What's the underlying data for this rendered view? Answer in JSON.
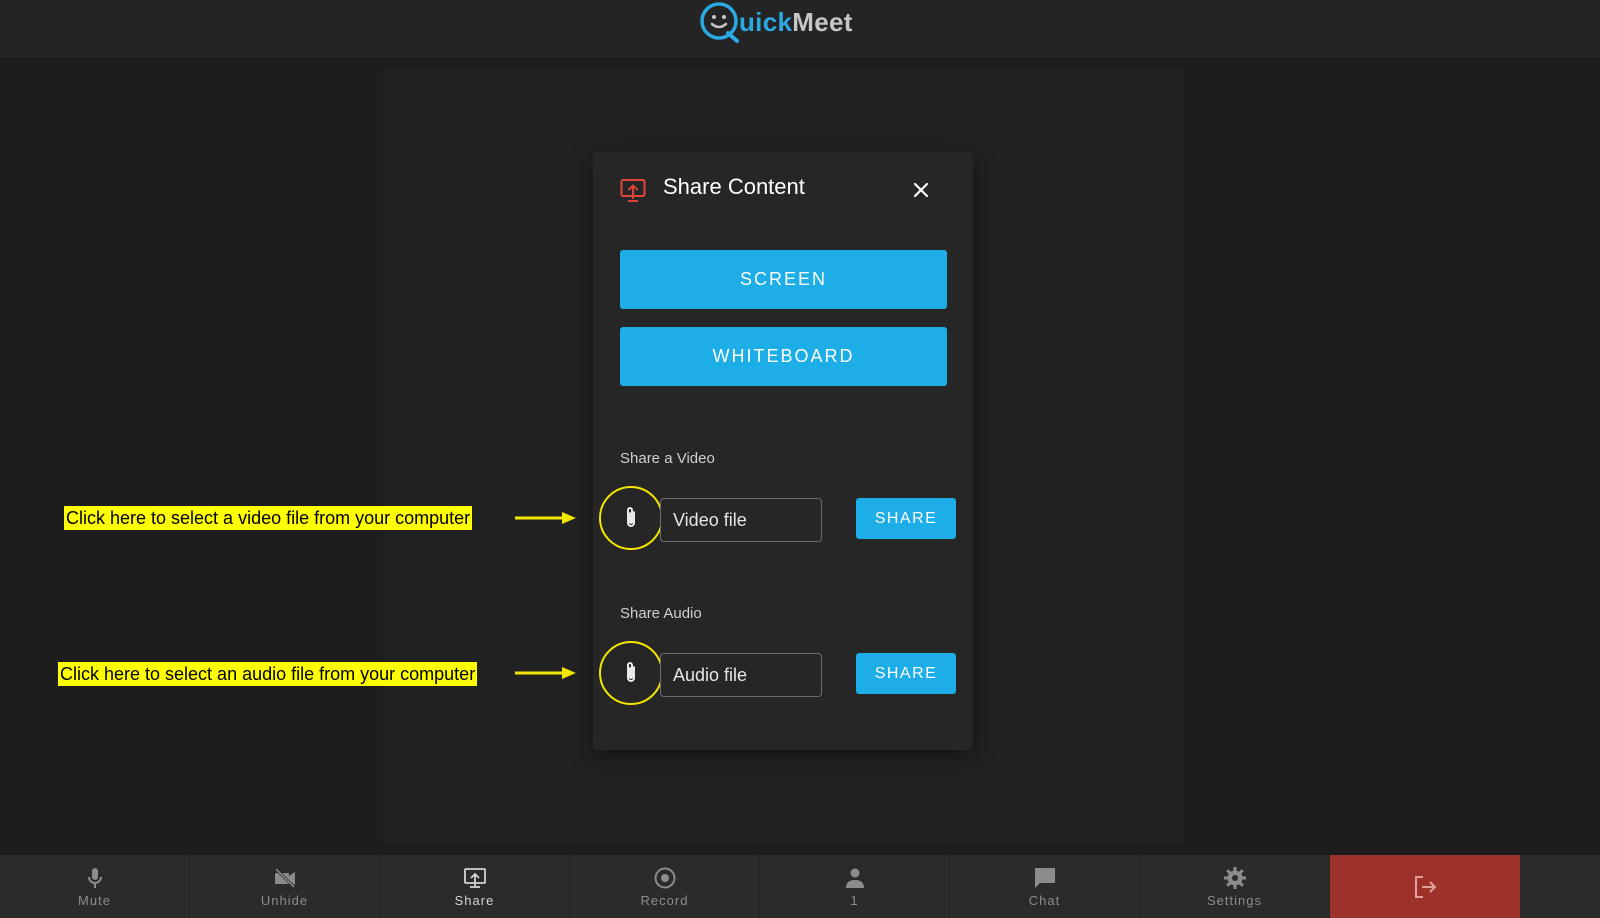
{
  "header": {
    "logo_prefix": "Q",
    "logo_part1": "uick",
    "logo_part2": "Meet"
  },
  "modal": {
    "title": "Share Content",
    "title_icon": "screen-share-icon",
    "close_icon": "close-icon",
    "screen_button": "SCREEN",
    "whiteboard_button": "WHITEBOARD",
    "video_section_label": "Share a Video",
    "video_input_placeholder": "Video file",
    "video_share_button": "SHARE",
    "audio_section_label": "Share Audio",
    "audio_input_placeholder": "Audio file",
    "audio_share_button": "SHARE",
    "attach_icon": "paperclip-icon"
  },
  "annotations": {
    "video": "Click here to select a video file from your computer",
    "audio": "Click here to select an audio file from your computer",
    "highlight_color": "#ffff00"
  },
  "toolbar": {
    "items": [
      {
        "label": "Mute",
        "icon": "microphone-icon"
      },
      {
        "label": "Unhide",
        "icon": "video-off-icon"
      },
      {
        "label": "Share",
        "icon": "screen-share-icon"
      },
      {
        "label": "Record",
        "icon": "record-icon"
      },
      {
        "label": "1",
        "icon": "person-icon"
      },
      {
        "label": "Chat",
        "icon": "chat-bubble-icon"
      },
      {
        "label": "Settings",
        "icon": "gear-icon"
      }
    ],
    "leave_icon": "exit-icon"
  },
  "colors": {
    "accent": "#1daee8",
    "leave": "#9c3129",
    "brand_blue": "#2aa9e3",
    "annotation_ring": "#f3e600",
    "share_icon_red": "#e0453a"
  }
}
